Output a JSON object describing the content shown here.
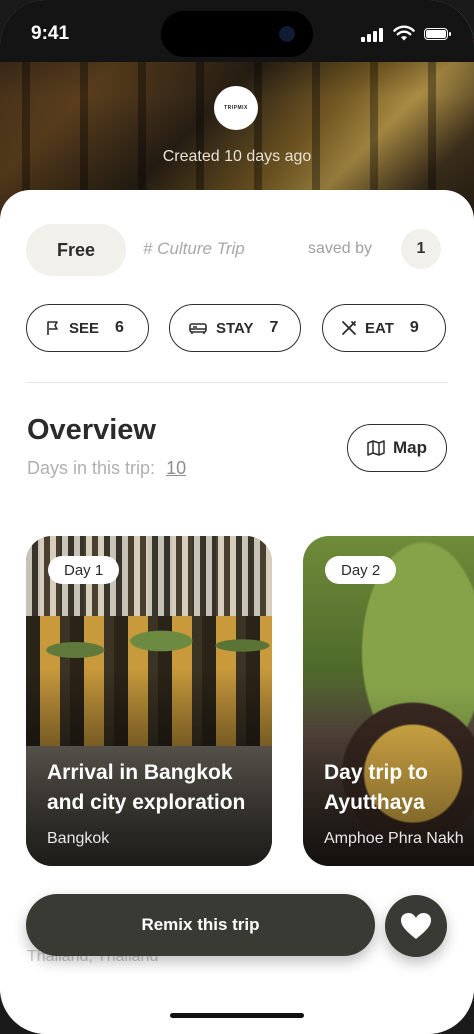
{
  "status_bar": {
    "time": "9:41"
  },
  "hero": {
    "logo_text": "TRIPMIX",
    "created_text": "Created  10  days ago"
  },
  "trip": {
    "price_label": "Free",
    "tag": "# Culture Trip",
    "saved_by_label": "saved by",
    "saved_count": "1"
  },
  "categories": [
    {
      "label": "SEE",
      "count": "6",
      "icon": "flag-icon"
    },
    {
      "label": "STAY",
      "count": "7",
      "icon": "bed-icon"
    },
    {
      "label": "EAT",
      "count": "9",
      "icon": "utensils-icon"
    }
  ],
  "overview": {
    "title": "Overview",
    "days_label": "Days in this trip:",
    "days_value": "10",
    "map_label": "Map"
  },
  "days": [
    {
      "badge": "Day 1",
      "title": "Arrival in Bangkok and city exploration",
      "location": "Bangkok"
    },
    {
      "badge": "Day 2",
      "title": "Day trip to Ayutthaya",
      "location": "Amphoe Phra Nakh"
    }
  ],
  "behind_text": "Thailand, Thailand",
  "actions": {
    "remix_label": "Remix this trip",
    "favorite_icon": "heart-icon"
  }
}
